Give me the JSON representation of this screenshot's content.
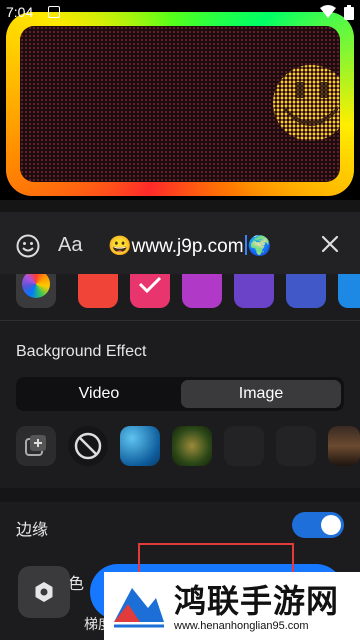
{
  "status_bar": {
    "time": "7:04",
    "icons": [
      "notification-icon",
      "wifi-icon",
      "battery-icon"
    ]
  },
  "preview": {
    "frame_colors": [
      "#ff2a2a",
      "#ff8a00",
      "#ffe800",
      "#57ff1a",
      "#00ff66"
    ],
    "dot_color": "#6b1e2a"
  },
  "input_bar": {
    "emoji_icon": "emoji-icon",
    "font_label": "Aa",
    "text_value": "😀www.j9p.com",
    "trailing_emoji": "🌍",
    "close_icon": "close-icon"
  },
  "swatches": [
    {
      "color": "rainbow",
      "icon": "color-wheel-icon"
    },
    {
      "color": "#f04438"
    },
    {
      "color": "#e8356d",
      "selected": true,
      "icon": "check-icon"
    },
    {
      "color": "#b039c8"
    },
    {
      "color": "#6a43c9"
    },
    {
      "color": "#4058c8"
    },
    {
      "color": "#1e88e5"
    }
  ],
  "background_effect": {
    "title": "Background Effect",
    "tabs": [
      {
        "label": "Video",
        "active": false
      },
      {
        "label": "Image",
        "active": true
      }
    ]
  },
  "edge": {
    "label": "边缘",
    "enabled": true
  },
  "color_row": {
    "label": "色",
    "gradient_label": "梯度"
  },
  "watermark": {
    "title": "鸿联手游网",
    "url": "www.henanhonglian95.com"
  },
  "colors": {
    "accent": "#1677ff",
    "toggle_on": "#1e6fd9",
    "background": "#1c1c1e",
    "highlight_box": "#e23b3b"
  }
}
